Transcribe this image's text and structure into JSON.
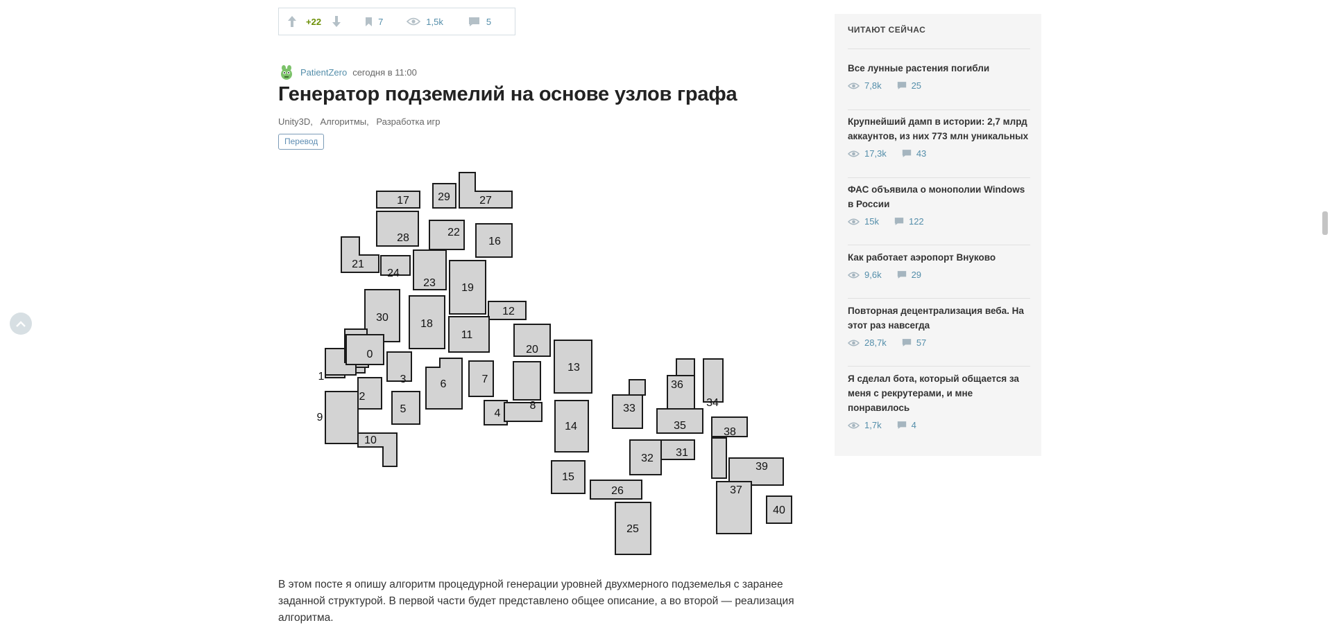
{
  "votebar": {
    "score": "+22",
    "bookmarks": "7",
    "views": "1,5k",
    "comments": "5"
  },
  "post": {
    "author": "PatientZero",
    "time": "сегодня в 11:00",
    "title": "Генератор подземелий на основе узлов графа",
    "hubs": [
      "Unity3D,",
      "Алгоритмы,",
      "Разработка игр"
    ],
    "badge": "Перевод",
    "lead": "В этом посте я опишу алгоритм процедурной генерации уровней двухмерного подземелья с заранее заданной структурой. В первой части будет представлено общее описание, а во второй — реализация алгоритма."
  },
  "dungeon_labels": [
    "0",
    "1",
    "2",
    "3",
    "4",
    "5",
    "6",
    "7",
    "8",
    "9",
    "10",
    "11",
    "12",
    "13",
    "14",
    "15",
    "16",
    "17",
    "18",
    "19",
    "20",
    "21",
    "22",
    "23",
    "24",
    "25",
    "26",
    "27",
    "28",
    "29",
    "30",
    "31",
    "32",
    "33",
    "34",
    "35",
    "36",
    "37",
    "38",
    "39",
    "40"
  ],
  "sidebar": {
    "heading": "ЧИТАЮТ СЕЙЧАС",
    "items": [
      {
        "title": "Все лунные растения погибли",
        "views": "7,8k",
        "comments": "25"
      },
      {
        "title": "Крупнейший дамп в истории: 2,7 млрд аккаунтов, из них 773 млн уникальных",
        "views": "17,3k",
        "comments": "43"
      },
      {
        "title": "ФАС объявила о монополии Windows в России",
        "views": "15k",
        "comments": "122"
      },
      {
        "title": "Как работает аэропорт Внуково",
        "views": "9,6k",
        "comments": "29"
      },
      {
        "title": "Повторная децентрализация веба. На этот раз навсегда",
        "views": "28,7k",
        "comments": "57"
      },
      {
        "title": "Я сделал бота, который общается за меня с рекрутерами, и мне понравилось",
        "views": "1,7k",
        "comments": "4"
      }
    ]
  },
  "colors": {
    "link": "#548eaa",
    "score_positive": "#6c9007",
    "room_fill": "#d3d3d3",
    "sidebar_bg": "#f5f5f5"
  },
  "icons": [
    "arrow-up-icon",
    "arrow-down-icon",
    "bookmark-icon",
    "eye-icon",
    "comment-icon",
    "chevron-up-icon",
    "avatar-icon"
  ]
}
